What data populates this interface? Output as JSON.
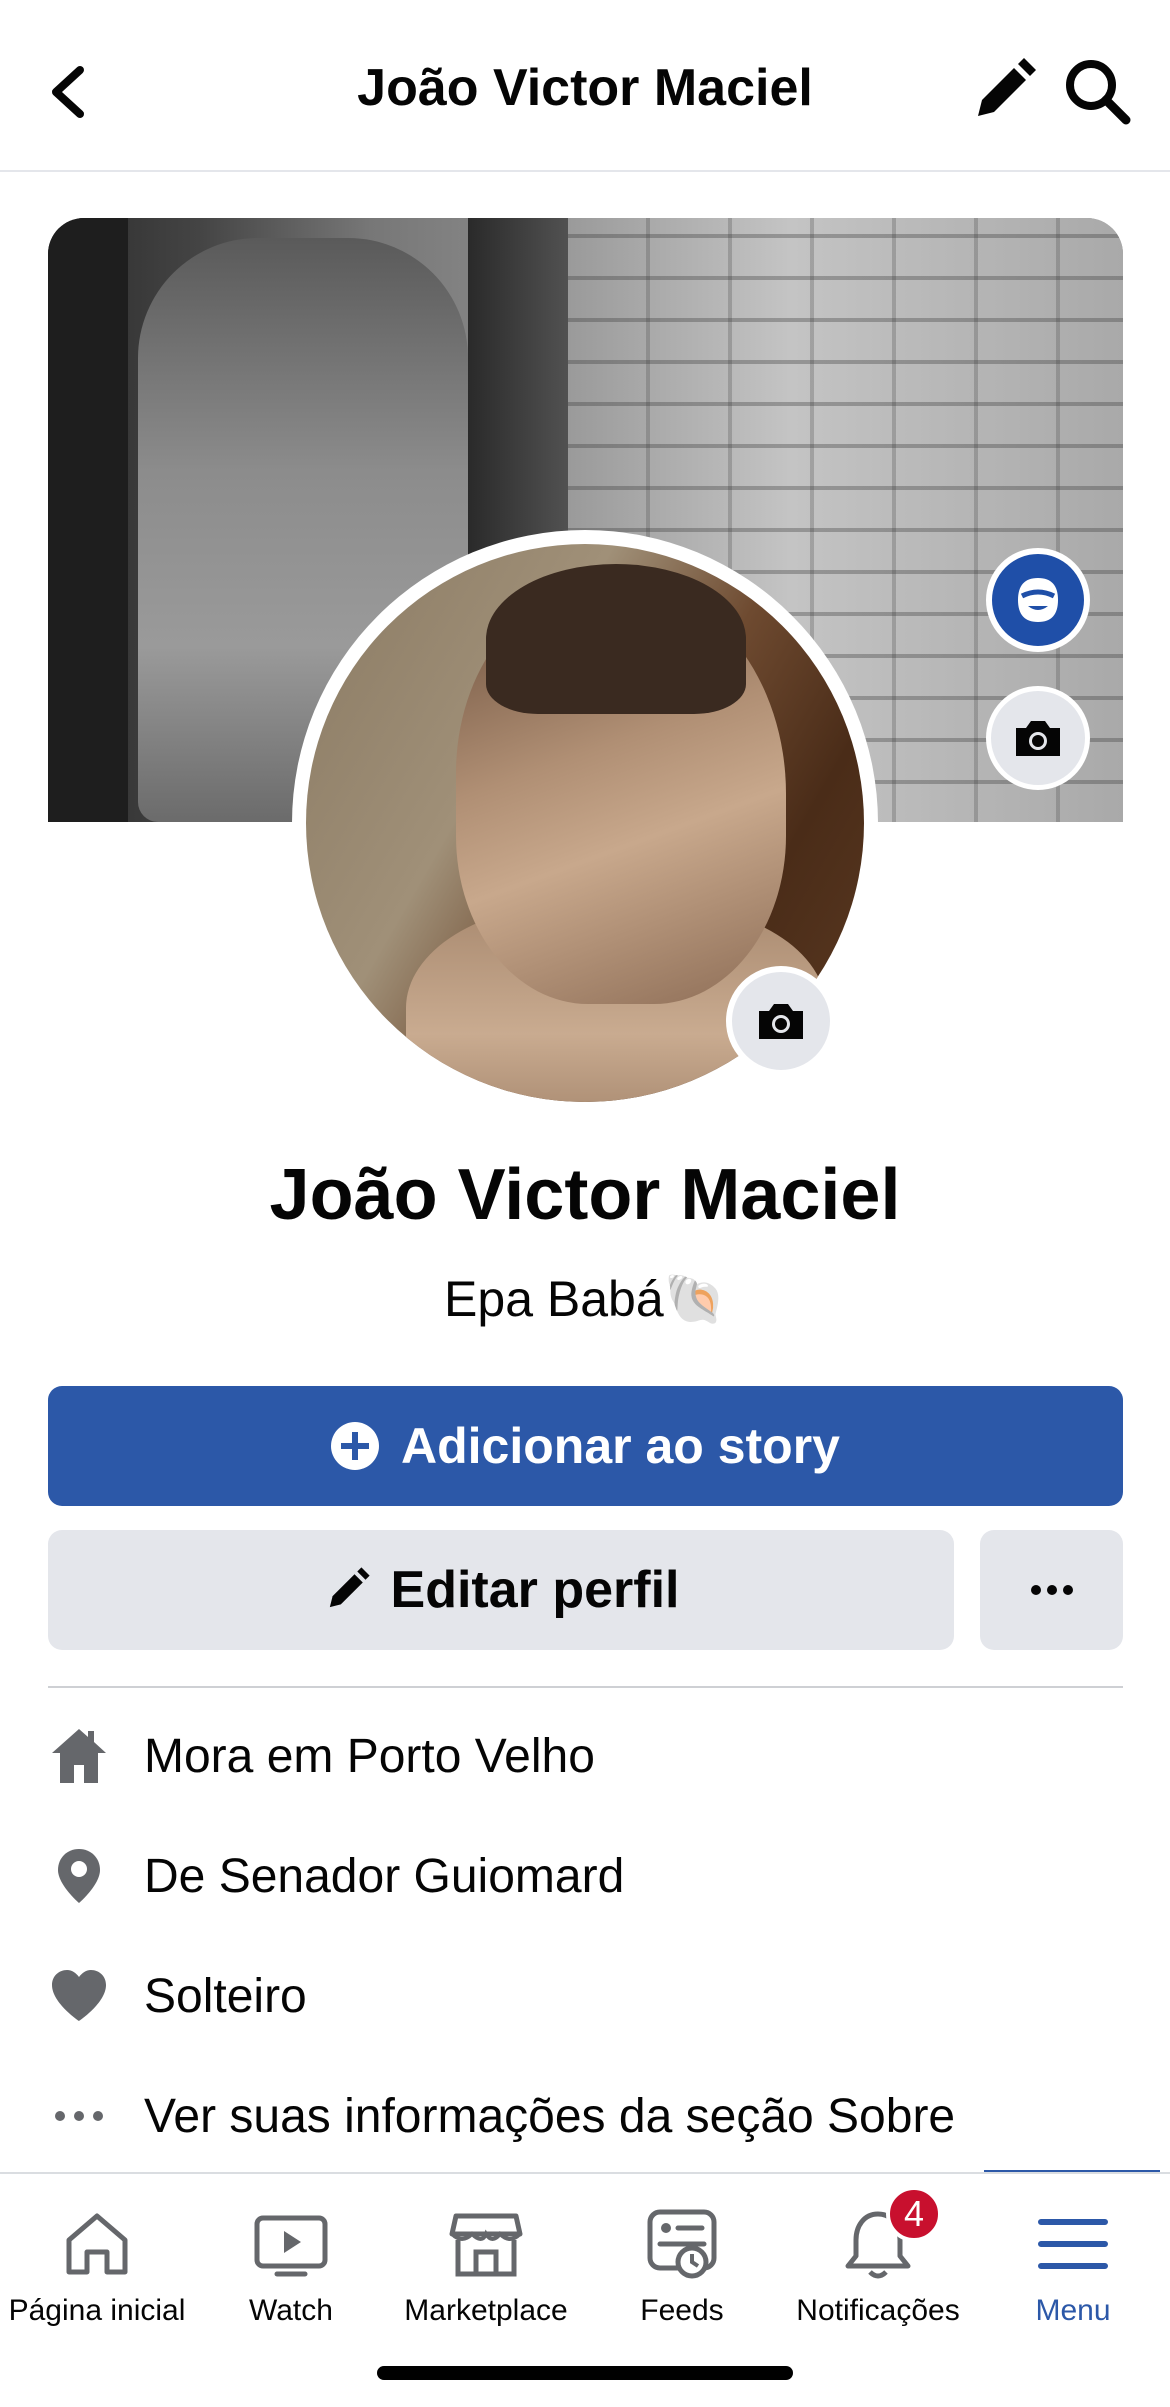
{
  "header": {
    "title": "João Victor Maciel",
    "back_icon": "chevron-left-icon",
    "edit_icon": "pencil-icon",
    "search_icon": "search-icon"
  },
  "profile": {
    "name": "João Victor Maciel",
    "bio": "Epa Babá🐚"
  },
  "actions": {
    "story_label": "Adicionar ao story",
    "edit_label": "Editar perfil",
    "more_icon": "more-dots-icon"
  },
  "info": [
    {
      "prefix": "Mora em ",
      "value": "Porto Velho",
      "icon": "home-icon"
    },
    {
      "prefix": "De ",
      "value": "Senador Guiomard",
      "icon": "location-pin-icon"
    },
    {
      "prefix": "",
      "value": "Solteiro",
      "icon": "heart-icon"
    },
    {
      "prefix": "",
      "value": "Ver suas informações da seção Sobre",
      "icon": "more-dots-icon"
    }
  ],
  "tabs": [
    {
      "label": "Página inicial",
      "icon": "home-icon"
    },
    {
      "label": "Watch",
      "icon": "video-icon"
    },
    {
      "label": "Marketplace",
      "icon": "marketplace-icon"
    },
    {
      "label": "Feeds",
      "icon": "feeds-icon"
    },
    {
      "label": "Notificações",
      "icon": "bell-icon",
      "badge": "4"
    },
    {
      "label": "Menu",
      "icon": "menu-icon",
      "active": true
    }
  ],
  "colors": {
    "accent": "#2c58a8",
    "badge": "#c8102e",
    "button_gray": "#e4e6eb"
  }
}
